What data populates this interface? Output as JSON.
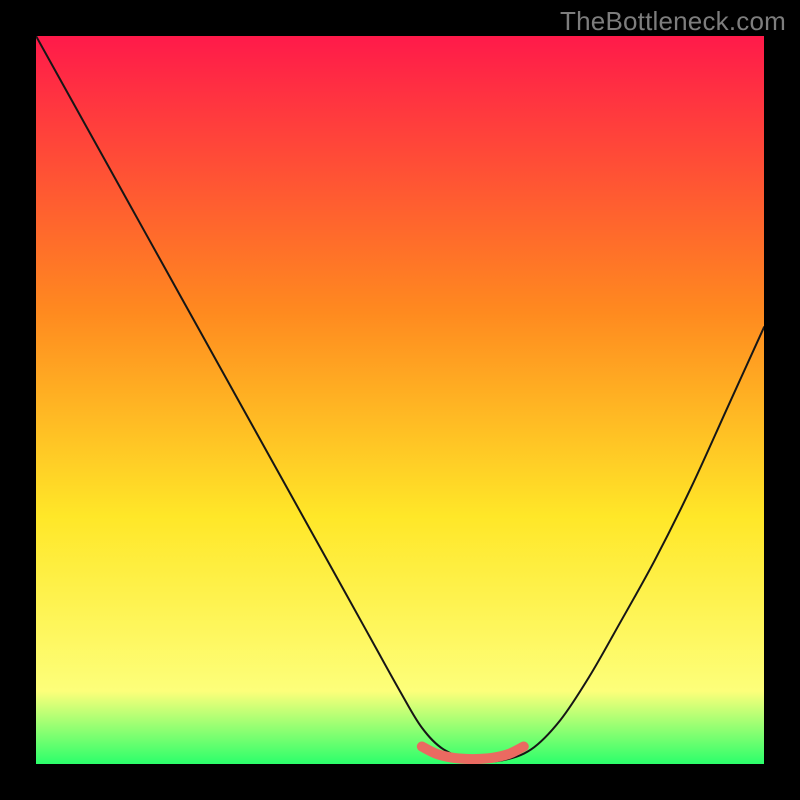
{
  "attribution": "TheBottleneck.com",
  "colors": {
    "black": "#000000",
    "gradient_top": "#ff1a4a",
    "gradient_mid1": "#ff8a1f",
    "gradient_mid2": "#ffe728",
    "gradient_mid3": "#fdff7a",
    "gradient_bottom": "#2bff6b",
    "curve": "#161616",
    "marker": "#ea6a61"
  },
  "chart_data": {
    "type": "line",
    "title": "",
    "xlabel": "",
    "ylabel": "",
    "xlim": [
      0,
      100
    ],
    "ylim": [
      0,
      100
    ],
    "series": [
      {
        "name": "bottleneck-curve",
        "x": [
          0,
          5,
          10,
          15,
          20,
          25,
          30,
          35,
          40,
          45,
          50,
          53,
          56,
          60,
          64,
          68,
          72,
          76,
          80,
          85,
          90,
          95,
          100
        ],
        "y": [
          100,
          91,
          82,
          73,
          64,
          55,
          46,
          37,
          28,
          19,
          10,
          5,
          2,
          0.5,
          0.5,
          2,
          6,
          12,
          19,
          28,
          38,
          49,
          60
        ]
      },
      {
        "name": "optimal-marker",
        "x": [
          53,
          55,
          57,
          59,
          61,
          63,
          65,
          67
        ],
        "y": [
          2.4,
          1.4,
          0.9,
          0.7,
          0.7,
          0.9,
          1.4,
          2.4
        ]
      }
    ],
    "annotations": [
      {
        "text": "TheBottleneck.com",
        "pos": "top-right"
      }
    ]
  }
}
